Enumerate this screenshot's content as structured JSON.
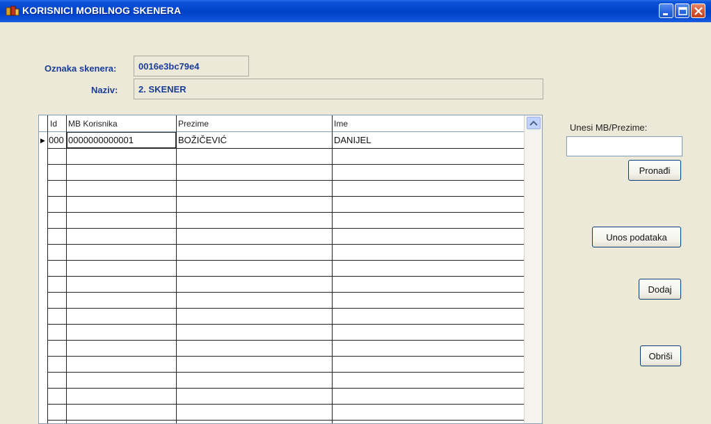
{
  "window": {
    "title": "KORISNICI MOBILNOG SKENERA",
    "icon": "app-icon",
    "controls": [
      "minimize-icon",
      "maximize-icon",
      "close-icon"
    ]
  },
  "form": {
    "scanner_code_label": "Oznaka skenera:",
    "scanner_code_value": "0016e3bc79e4",
    "name_label": "Naziv:",
    "name_value": "2. SKENER"
  },
  "grid": {
    "columns": [
      "Id",
      "MB Korisnika",
      "Prezime",
      "Ime"
    ],
    "rows": [
      {
        "id": "000",
        "mb": "0000000000001",
        "prezime": "BOŽIČEVIĆ",
        "ime": "DANIJEL"
      }
    ]
  },
  "search": {
    "label": "Unesi  MB/Prezime:",
    "value": "",
    "placeholder": ""
  },
  "buttons": {
    "find": "Pronađi",
    "enter_data": "Unos podataka",
    "add": "Dodaj",
    "delete": "Obriši"
  },
  "colors": {
    "titlebar": "#0042c8",
    "form_label": "#1a3c98",
    "window_bg": "#ece9d8"
  }
}
